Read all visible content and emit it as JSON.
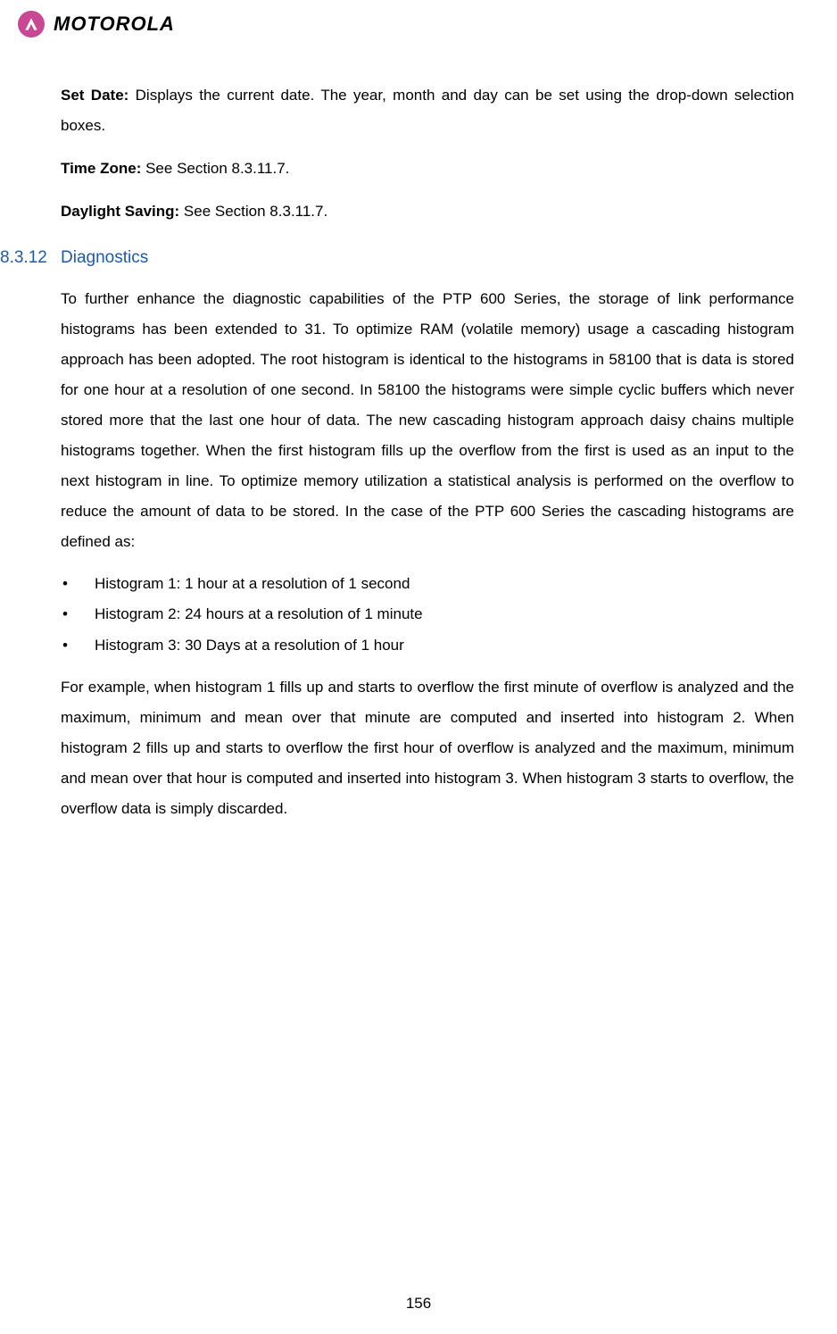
{
  "logo": {
    "brand": "MOTOROLA"
  },
  "para1": {
    "label": "Set Date:",
    "text": " Displays the current date. The year, month and day can be set using the drop-down selection boxes."
  },
  "para2": {
    "label": "Time Zone:",
    "text": " See Section 8.3.11.7."
  },
  "para3": {
    "label": "Daylight Saving:",
    "text": " See Section 8.3.11.7."
  },
  "section": {
    "number": "8.3.12",
    "title": "Diagnostics"
  },
  "diag_para": "To further enhance the diagnostic capabilities of the PTP 600 Series, the storage of link performance histograms has been extended to 31. To optimize RAM (volatile memory) usage a cascading histogram approach has been adopted. The root histogram is identical to the histograms in 58100 that is data is stored for one hour at a resolution of one second. In 58100 the histograms were simple cyclic buffers which never stored more that the last one hour of data. The new cascading histogram approach daisy chains multiple histograms together. When the first histogram fills up the overflow from the first is used as an input to the next histogram in line. To optimize memory utilization a statistical analysis is performed on the overflow to reduce the amount of data to be stored. In the case of the PTP 600 Series the cascading histograms are defined as:",
  "bullets": [
    "Histogram 1: 1 hour at a resolution of 1 second",
    "Histogram 2: 24 hours at a resolution of 1 minute",
    "Histogram 3: 30 Days at a resolution of 1 hour"
  ],
  "example_para": "For example, when histogram 1 fills up and starts to overflow the first minute of overflow is analyzed and the maximum, minimum and mean over that minute are computed and inserted into histogram 2. When histogram 2 fills up and starts to overflow the first hour of overflow is analyzed and the maximum, minimum and mean over that hour is computed and inserted into histogram 3. When histogram 3 starts to overflow, the overflow data is simply discarded.",
  "page_number": "156"
}
